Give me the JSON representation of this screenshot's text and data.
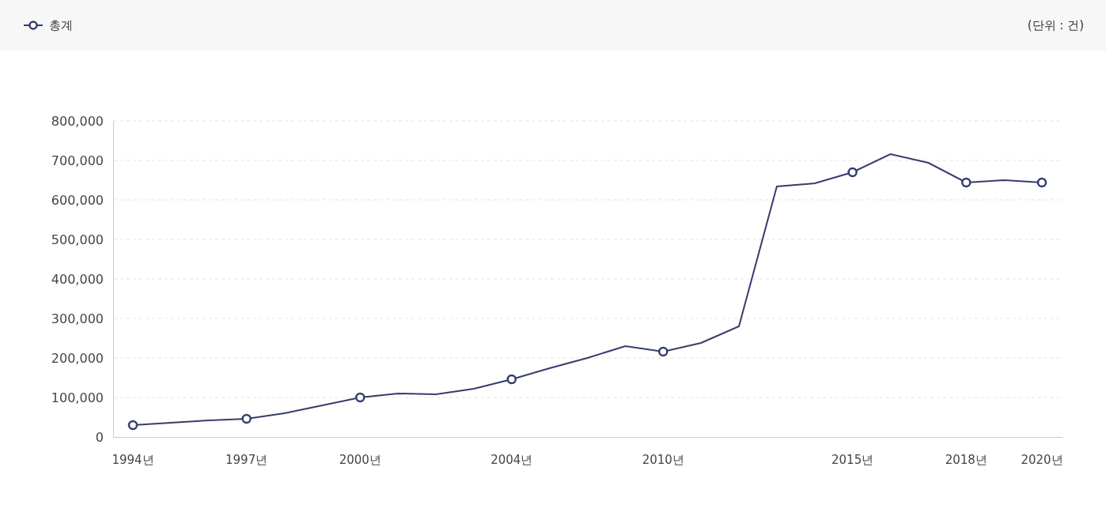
{
  "unit": "(단위 : 건)",
  "chart_data": {
    "type": "line",
    "grid": true,
    "ylim": [
      0,
      800000
    ],
    "categories": [
      "1994년",
      null,
      null,
      "1997년",
      null,
      null,
      "2000년",
      null,
      null,
      null,
      "2004년",
      null,
      null,
      null,
      "2010년",
      null,
      null,
      null,
      null,
      "2015년",
      null,
      null,
      "2018년",
      null,
      "2020년"
    ],
    "yticks": [
      {
        "value": 0,
        "label": "0"
      },
      {
        "value": 100000,
        "label": "100,000"
      },
      {
        "value": 200000,
        "label": "200,000"
      },
      {
        "value": 300000,
        "label": "300,000"
      },
      {
        "value": 400000,
        "label": "400,000"
      },
      {
        "value": 500000,
        "label": "500,000"
      },
      {
        "value": 600000,
        "label": "600,000"
      },
      {
        "value": 700000,
        "label": "700,000"
      },
      {
        "value": 800000,
        "label": "800,000"
      }
    ],
    "series": [
      {
        "name": "총계",
        "color": "#363d6e",
        "values": [
          30000,
          36000,
          42000,
          46000,
          60000,
          80000,
          100000,
          110000,
          108000,
          122000,
          146000,
          174000,
          200000,
          230000,
          216000,
          238000,
          280000,
          634000,
          642000,
          670000,
          716000,
          694000,
          644000,
          650000,
          644000
        ]
      }
    ]
  }
}
